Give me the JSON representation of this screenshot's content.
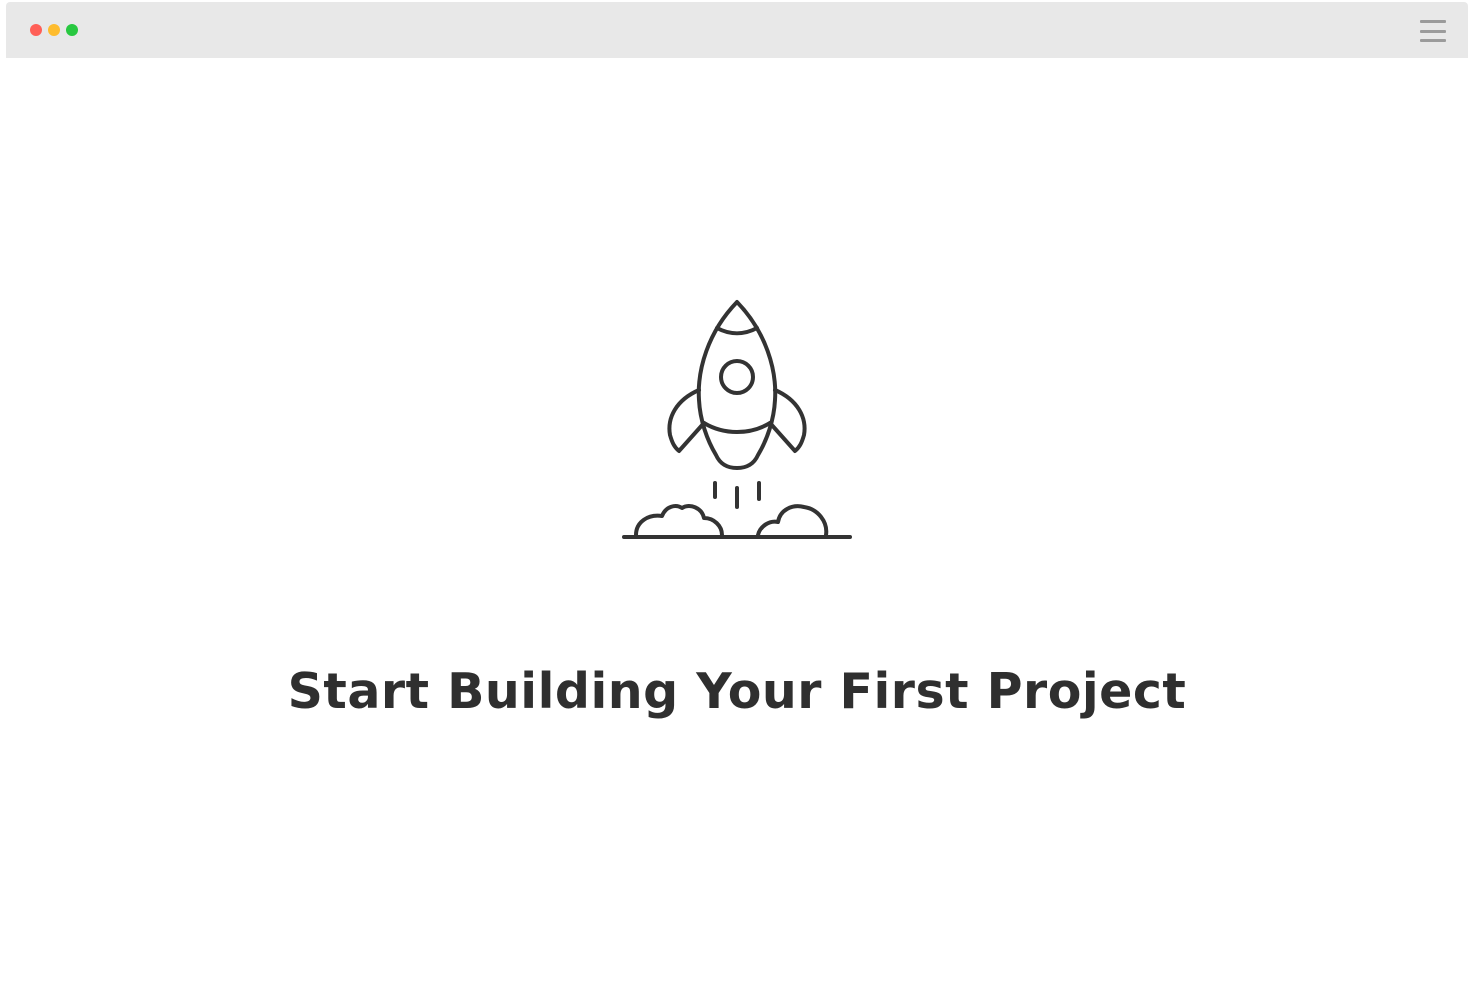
{
  "window": {
    "traffic_lights": [
      {
        "name": "close",
        "color": "#ff5f57"
      },
      {
        "name": "minimize",
        "color": "#febc2e"
      },
      {
        "name": "maximize",
        "color": "#28c840"
      }
    ],
    "menu_icon": "hamburger-menu-icon"
  },
  "main": {
    "illustration_icon": "rocket-launch-icon",
    "headline": "Start Building Your First Project"
  },
  "colors": {
    "stroke": "#333333",
    "bar_background": "#e8e8e8",
    "page_background": "#ffffff"
  }
}
